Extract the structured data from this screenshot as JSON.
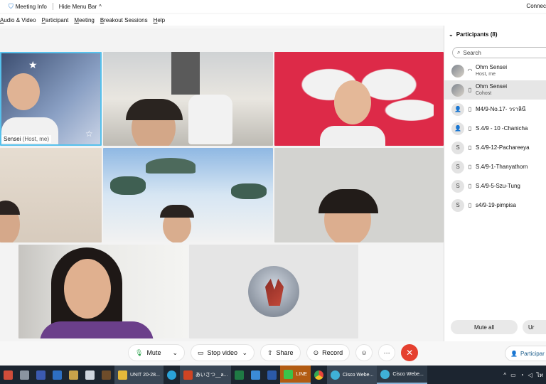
{
  "topbar": {
    "meeting_info": "Meeting Info",
    "hide_menu": "Hide Menu Bar",
    "connection": "Connec"
  },
  "menu": [
    "Audio & Video",
    "Participant",
    "Meeting",
    "Breakout Sessions",
    "Help"
  ],
  "tiles": {
    "host_name": "Sensei",
    "host_role": "(Host, me)"
  },
  "panel": {
    "title": "Participants (8)",
    "search_placeholder": "Search",
    "participants": [
      {
        "name": "Ohm Sensei",
        "role": "Host, me",
        "avatar": "",
        "device": "headset-icon"
      },
      {
        "name": "Ohm Sensei",
        "role": "Cohost",
        "avatar": "",
        "device": "phone-icon"
      },
      {
        "name": "M4/9-No.17- วราลินี",
        "role": "",
        "avatar": "",
        "device": "phone-icon"
      },
      {
        "name": "S.4/9 - 10 -Chanicha",
        "role": "",
        "avatar": "",
        "device": "phone-icon"
      },
      {
        "name": "S.4/9-12-Pachareeya",
        "role": "",
        "avatar": "S",
        "device": "phone-icon"
      },
      {
        "name": "S.4/9-1-Thanyathorn",
        "role": "",
        "avatar": "S",
        "device": "phone-icon"
      },
      {
        "name": "S.4/9-5-Szu-Tung",
        "role": "",
        "avatar": "S",
        "device": "phone-icon"
      },
      {
        "name": "s4/9-19-pimpisa",
        "role": "",
        "avatar": "S",
        "device": "phone-icon"
      }
    ],
    "mute_all": "Mute all",
    "unmute_all": "Ur"
  },
  "controls": {
    "mute": "Mute",
    "stop_video": "Stop video",
    "share": "Share",
    "record": "Record",
    "more": "⋯",
    "end": "✕",
    "participants": "Participar"
  },
  "taskbar": {
    "unit": "UNIT 20-28...",
    "ppt": "あいさつ__a...",
    "line": "LINE",
    "cisco1": "Cisco Webe...",
    "cisco2": "Cisco Webe..."
  }
}
